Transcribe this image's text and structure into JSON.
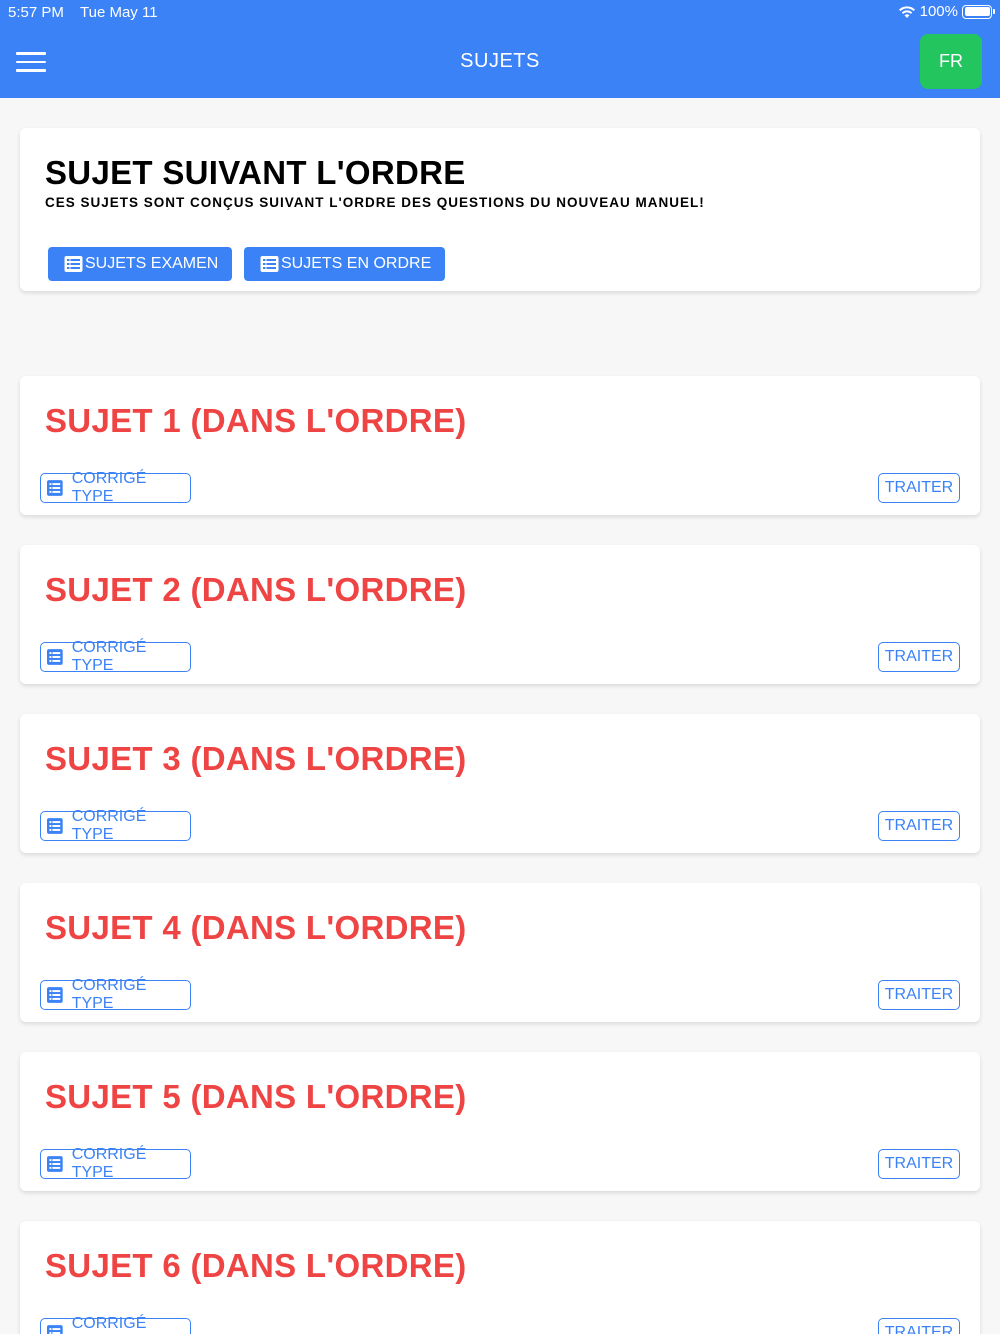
{
  "status_bar": {
    "time": "5:57 PM",
    "date": "Tue May 11",
    "battery": "100%"
  },
  "header": {
    "title": "SUJETS",
    "language": "FR",
    "menu_icon": "hamburger-icon"
  },
  "intro": {
    "title": "SUJET SUIVANT L'ORDRE",
    "subtitle": "CES SUJETS SONT CONÇUS SUIVANT L'ORDRE DES QUESTIONS DU NOUVEAU MANUEL!",
    "btn_exam": "SUJETS EXAMEN",
    "btn_order": "SUJETS EN ORDRE",
    "btn_icon": "list-icon"
  },
  "sujets": [
    {
      "title": "SUJET 1 (DANS L'ORDRE)",
      "corrige": "CORRIGÉ TYPE",
      "traiter": "TRAITER"
    },
    {
      "title": "SUJET 2 (DANS L'ORDRE)",
      "corrige": "CORRIGÉ TYPE",
      "traiter": "TRAITER"
    },
    {
      "title": "SUJET 3 (DANS L'ORDRE)",
      "corrige": "CORRIGÉ TYPE",
      "traiter": "TRAITER"
    },
    {
      "title": "SUJET 4 (DANS L'ORDRE)",
      "corrige": "CORRIGÉ TYPE",
      "traiter": "TRAITER"
    },
    {
      "title": "SUJET 5 (DANS L'ORDRE)",
      "corrige": "CORRIGÉ TYPE",
      "traiter": "TRAITER"
    },
    {
      "title": "SUJET 6 (DANS L'ORDRE)",
      "corrige": "CORRIGÉ TYPE",
      "traiter": "TRAITER"
    }
  ],
  "colors": {
    "primary": "#3b82f6",
    "accent_green": "#22c55e",
    "sujet_title": "#ef4444"
  }
}
